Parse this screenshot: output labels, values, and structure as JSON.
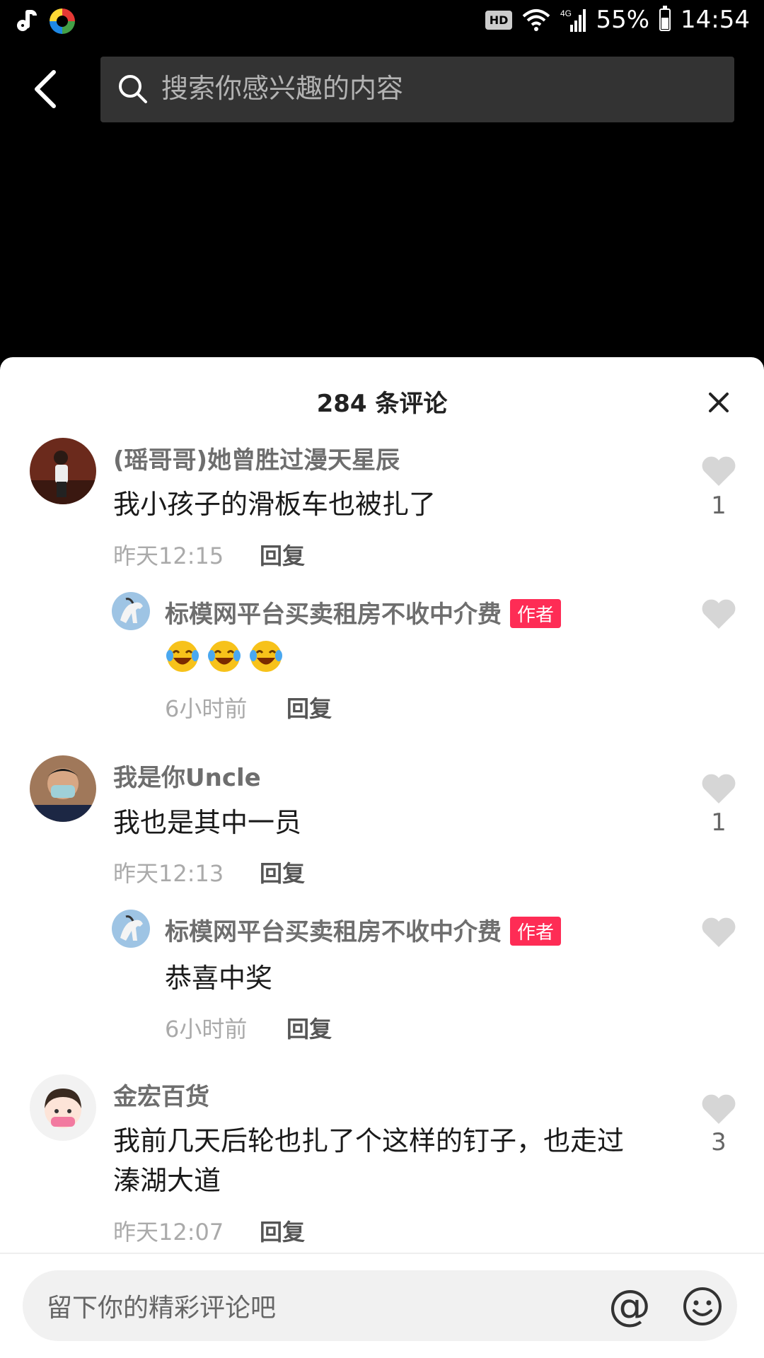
{
  "status_bar": {
    "hd": "HD",
    "network": "4G",
    "battery": "55%",
    "time": "14:54"
  },
  "search": {
    "placeholder": "搜索你感兴趣的内容"
  },
  "comments_sheet": {
    "title": "284 条评论",
    "comments": [
      {
        "username": "(瑶哥哥)她曾胜过漫天星辰",
        "text": "我小孩子的滑板车也被扎了",
        "time": "昨天12:15",
        "reply": "回复",
        "likes": "1",
        "avatar": "person-photo-avatar",
        "replies": [
          {
            "username": "标模网平台买卖租房不收中介费",
            "badge": "作者",
            "emojis": [
              "laughing-tears-emoji",
              "laughing-tears-emoji",
              "laughing-tears-emoji"
            ],
            "time": "6小时前",
            "reply": "回复",
            "avatar": "horse-avatar"
          }
        ]
      },
      {
        "username": "我是你Uncle",
        "text": "我也是其中一员",
        "time": "昨天12:13",
        "reply": "回复",
        "likes": "1",
        "avatar": "masked-man-avatar",
        "replies": [
          {
            "username": "标模网平台买卖租房不收中介费",
            "badge": "作者",
            "text": "恭喜中奖",
            "time": "6小时前",
            "reply": "回复",
            "avatar": "horse-avatar"
          }
        ]
      },
      {
        "username": "金宏百货",
        "text": "我前几天后轮也扎了个这样的钉子，也走过",
        "text2": "溱湖大道",
        "time": "昨天12:07",
        "reply": "回复",
        "likes": "3",
        "avatar": "cartoon-girl-avatar"
      }
    ]
  },
  "input": {
    "placeholder": "留下你的精彩评论吧",
    "at": "@"
  },
  "colors": {
    "author_badge": "#fe2c55",
    "like_heart": "#d6d6d6"
  }
}
